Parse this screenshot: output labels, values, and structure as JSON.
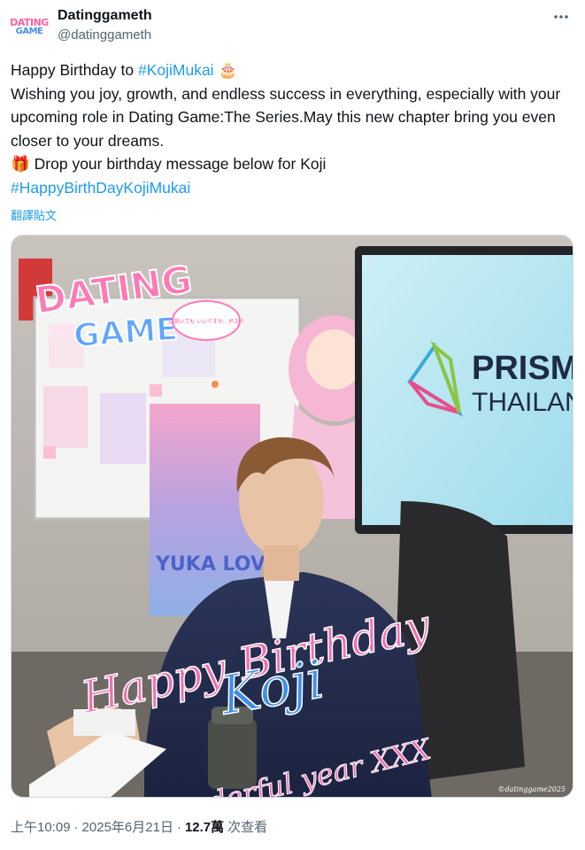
{
  "account": {
    "display_name": "Datinggameth",
    "handle": "@datinggameth",
    "avatar_text_line1": "DATING",
    "avatar_text_line2": "GAME"
  },
  "tweet": {
    "line1_prefix": "Happy Birthday to ",
    "line1_hashtag": "#KojiMukai",
    "line1_emoji": " 🎂",
    "line2": "Wishing you joy, growth, and endless success in everything, especially with your upcoming role in Dating Game:The Series.May this new chapter bring you even closer to your dreams.",
    "line3_emoji": "🎁 ",
    "line3": "Drop your birthday message below for Koji",
    "hashtag2": "#HappyBirthDayKojiMukai",
    "translate_label": "翻譯貼文"
  },
  "media": {
    "logo_line1": "DATING",
    "logo_line2": "GAME",
    "logo_bubble": "口説いても いいですか、ボス!?",
    "screen_brand1": "PRISM",
    "screen_brand2": "THAILAND",
    "poster_text": "YUKA LOVED",
    "overlay_line1": "Happy Birthday",
    "overlay_line2": "Koji",
    "overlay_line3": "Wish a wonderful year XXX",
    "watermark": "©datinggame2025"
  },
  "meta": {
    "time": "上午10:09",
    "sep1": "·",
    "date": "2025年6月21日",
    "sep2": "·",
    "views_count": "12.7萬",
    "views_label": "次查看"
  },
  "colors": {
    "link": "#1d9bf0",
    "secondary_text": "#536471",
    "overlay_pink": "#f06fb0",
    "overlay_blue": "#3f8fe8"
  }
}
